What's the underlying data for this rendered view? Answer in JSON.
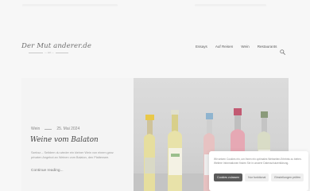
{
  "site": {
    "logo_text": "Der Mut anderer.de",
    "logo_tagline": "— est —"
  },
  "nav": {
    "items": [
      "Essays",
      "Auf Reisen",
      "Wein",
      "Restaurants"
    ]
  },
  "icons": {
    "search": "search-icon"
  },
  "post": {
    "category": "Wein",
    "date": "25. Mai 2024",
    "title": "Weine vom Balaton",
    "excerpt": "Szeksz – Seitdem du wieder ein kleiner Wein von einem ganz privaten Angebot an Weinen vom Balaton, den Plattensee.",
    "read_more": "Continue reading..."
  },
  "cookie": {
    "text": "Wir setzen Cookies ein, um Ihnen ein optimales Webseiten-Erlebnis zu bieten. Weitere Informationen finden Sie in unserer Datenschutzerklärung.",
    "accept_label": "Cookies zulassen",
    "deny_label": "Nur funktional",
    "settings_label": "Einstellungen prüfen"
  },
  "colors": {
    "background": "#f7f7f7",
    "accept_button": "#5b5b5b"
  }
}
